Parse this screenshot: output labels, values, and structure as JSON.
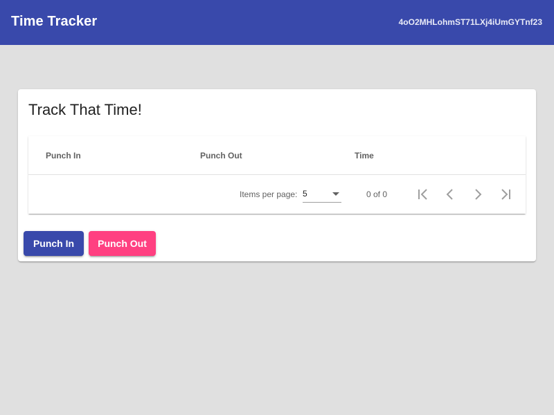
{
  "toolbar": {
    "title": "Time Tracker",
    "user_id": "4oO2MHLohmST71LXj4iUmGYTnf23",
    "color": "#3949ab"
  },
  "card": {
    "title": "Track That Time!"
  },
  "table": {
    "columns": [
      "Punch In",
      "Punch Out",
      "Time"
    ],
    "rows": []
  },
  "paginator": {
    "items_per_page_label": "Items per page:",
    "items_per_page_value": "5",
    "range_label": "0 of 0",
    "icons": [
      "first-page-icon",
      "previous-page-icon",
      "next-page-icon",
      "last-page-icon"
    ]
  },
  "actions": {
    "punch_in_label": "Punch In",
    "punch_out_label": "Punch Out",
    "punch_in_color": "#3949ab",
    "punch_out_color": "#ff4081"
  }
}
